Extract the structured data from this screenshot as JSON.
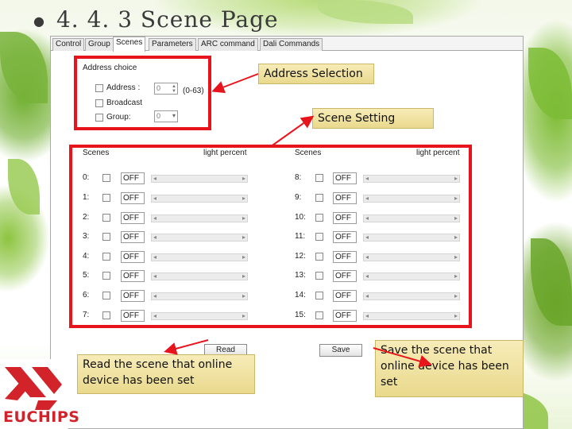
{
  "slide": {
    "title": "4. 4. 3  Scene  Page"
  },
  "tabs": [
    {
      "label": "Control"
    },
    {
      "label": "Group"
    },
    {
      "label": "Scenes",
      "active": true
    },
    {
      "label": "Parameters"
    },
    {
      "label": "ARC command"
    },
    {
      "label": "Dali Commands"
    }
  ],
  "address": {
    "group_title": "Address choice",
    "address_label": "Address :",
    "address_value": "0",
    "address_range": "(0-63)",
    "broadcast_label": "Broadcast",
    "group_label": "Group:",
    "group_value": "0"
  },
  "scenes": {
    "col_header_scene": "Scenes",
    "col_header_light": "light percent",
    "left": [
      {
        "idx": "0:",
        "value": "OFF"
      },
      {
        "idx": "1:",
        "value": "OFF"
      },
      {
        "idx": "2:",
        "value": "OFF"
      },
      {
        "idx": "3:",
        "value": "OFF"
      },
      {
        "idx": "4:",
        "value": "OFF"
      },
      {
        "idx": "5:",
        "value": "OFF"
      },
      {
        "idx": "6:",
        "value": "OFF"
      },
      {
        "idx": "7:",
        "value": "OFF"
      }
    ],
    "right": [
      {
        "idx": "8:",
        "value": "OFF"
      },
      {
        "idx": "9:",
        "value": "OFF"
      },
      {
        "idx": "10:",
        "value": "OFF"
      },
      {
        "idx": "11:",
        "value": "OFF"
      },
      {
        "idx": "12:",
        "value": "OFF"
      },
      {
        "idx": "13:",
        "value": "OFF"
      },
      {
        "idx": "14:",
        "value": "OFF"
      },
      {
        "idx": "15:",
        "value": "OFF"
      }
    ]
  },
  "buttons": {
    "read_label": "Read",
    "save_label": "Save"
  },
  "callouts": {
    "address_selection": "Address Selection",
    "scene_setting": "Scene Setting",
    "read_line1": "Read the scene that online",
    "read_line2": "device has been set",
    "save_line1": "Save the scene that",
    "save_line2": "online device has been",
    "save_line3": "set"
  },
  "logo": {
    "text": "EUCHIPS"
  },
  "colors": {
    "highlight_red": "#e8141b",
    "callout_bg": "#f0e3a4",
    "brand_red": "#d2232a"
  }
}
